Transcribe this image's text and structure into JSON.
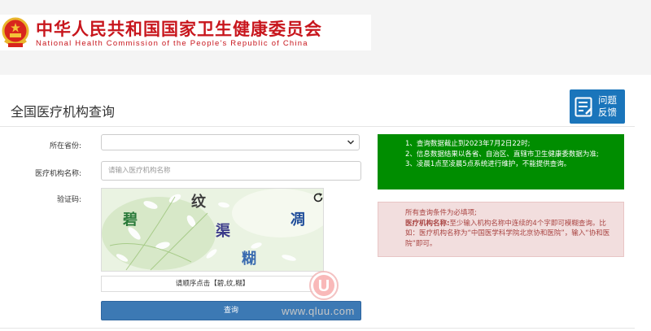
{
  "header": {
    "org_name_cn": "中华人民共和国国家卫生健康委员会",
    "org_name_en": "National Health Commission of the People's Republic of China"
  },
  "page": {
    "title": "全国医疗机构查询",
    "feedback_line1": "问题",
    "feedback_line2": "反馈"
  },
  "form": {
    "province_label": "所在省份:",
    "province_value": "",
    "name_label": "医疗机构名称:",
    "name_placeholder": "请输入医疗机构名称",
    "captcha_label": "验证码:",
    "captcha_chars": [
      "纹",
      "碧",
      "渠",
      "凋",
      "糊"
    ],
    "captcha_hint": "请顺序点击【碧,纹,糊】",
    "submit_label": "查询"
  },
  "notices": {
    "info": [
      "1、查询数据截止到2023年7月2日22时;",
      "2、信息数据结果以各省、自治区、直辖市卫生健康委数据为准;",
      "3、凌晨1点至凌晨5点系统进行维护，不能提供查询。"
    ],
    "required_line": "所有查询条件为必填项;",
    "name_rule_label": "医疗机构名称:",
    "name_rule_text": "至少输入机构名称中连续的4个字即可模糊查询。比如：医疗机构名称为“中国医学科学院北京协和医院”，输入“协和医院”即可。"
  },
  "watermark": {
    "letter": "U",
    "site": "www.qluu.com"
  },
  "colors": {
    "brand_red": "#c8161d",
    "primary_blue": "#3c79b4",
    "feedback_blue": "#1a75bb",
    "notice_green": "#008d00",
    "notice_red_bg": "#f2dede",
    "notice_red_text": "#a94442"
  }
}
